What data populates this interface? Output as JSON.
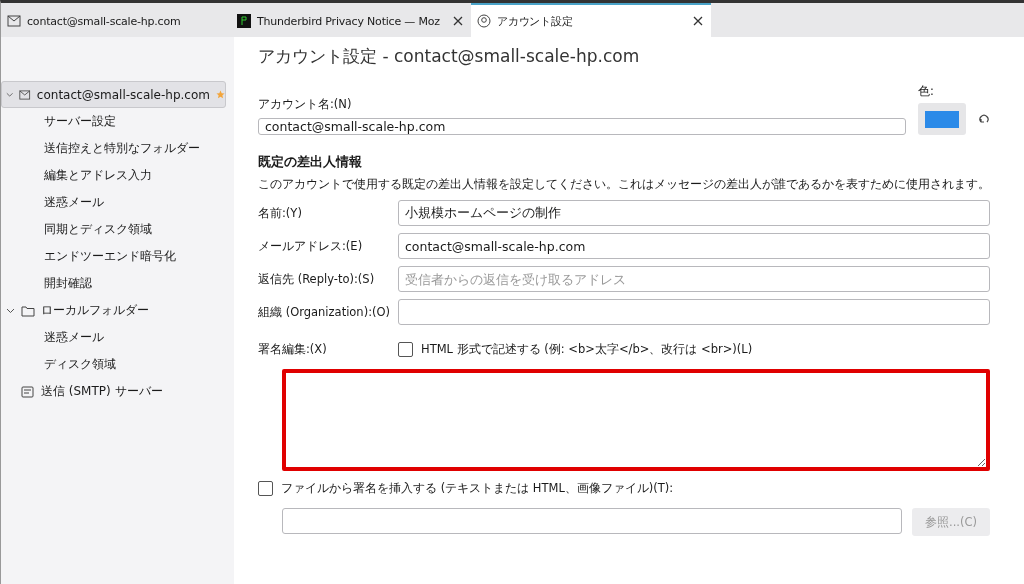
{
  "tabs": [
    {
      "label": "contact@small-scale-hp.com",
      "selected": false,
      "closable": false
    },
    {
      "label": "Thunderbird Privacy Notice — Moz",
      "selected": false,
      "closable": true
    },
    {
      "label": "アカウント設定",
      "selected": true,
      "closable": true
    }
  ],
  "sidebar": {
    "items": [
      {
        "label": "contact@small-scale-hp.com",
        "expanded": true,
        "selected": true,
        "default": true,
        "children": [
          {
            "label": "サーバー設定",
            "selected": false
          },
          {
            "label": "送信控えと特別なフォルダー",
            "selected": false
          },
          {
            "label": "編集とアドレス入力",
            "selected": false
          },
          {
            "label": "迷惑メール",
            "selected": false
          },
          {
            "label": "同期とディスク領域",
            "selected": false
          },
          {
            "label": "エンドツーエンド暗号化",
            "selected": false
          },
          {
            "label": "開封確認",
            "selected": false
          }
        ]
      },
      {
        "label": "ローカルフォルダー",
        "expanded": true,
        "selected": false,
        "default": false,
        "children": [
          {
            "label": "迷惑メール",
            "selected": false
          },
          {
            "label": "ディスク領域",
            "selected": false
          }
        ]
      },
      {
        "label": "送信 (SMTP) サーバー",
        "selected": false,
        "default": false
      }
    ]
  },
  "page": {
    "title": "アカウント設定 - contact@small-scale-hp.com",
    "account_name": {
      "label": "アカウント名:(N)",
      "value": "contact@small-scale-hp.com"
    },
    "color": {
      "label": "色:",
      "color": "#2b8ae8"
    },
    "identity": {
      "heading": "既定の差出人情報",
      "description": "このアカウントで使用する既定の差出人情報を設定してください。これはメッセージの差出人が誰であるかを表すために使用されます。",
      "fields": [
        {
          "label": "名前:(Y)",
          "value": "小規模ホームページの制作"
        },
        {
          "label": "メールアドレス:(E)",
          "value": "contact@small-scale-hp.com"
        },
        {
          "label": "返信先 (Reply-to):(S)",
          "placeholder": "受信者からの返信を受け取るアドレス"
        },
        {
          "label": "組織 (Organization):(O)"
        }
      ]
    },
    "signature": {
      "label": "署名編集:(X)",
      "html_checkbox": {
        "label": "HTML 形式で記述する (例: <b>太字</b>、改行は <br>)(L)",
        "checked": false
      },
      "highlighted": true
    },
    "file_signature": {
      "label": "ファイルから署名を挿入する (テキストまたは HTML、画像ファイル)(T):",
      "checked": false,
      "browse_button": "参照...(C)"
    }
  }
}
